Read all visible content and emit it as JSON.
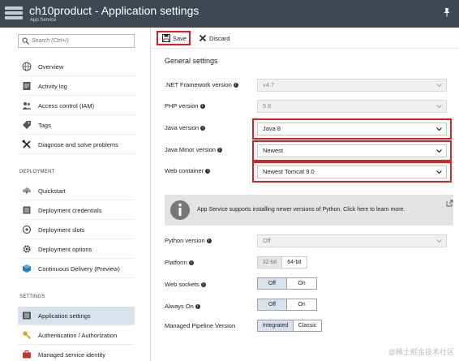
{
  "window": {
    "title": "ch10product - Application settings",
    "subtitle": "App Service"
  },
  "sidebar": {
    "search_placeholder": "Search (Ctrl+/)",
    "items": [
      {
        "label": "Overview",
        "icon": "globe-icon"
      },
      {
        "label": "Activity log",
        "icon": "activity-log-icon"
      },
      {
        "label": "Access control (IAM)",
        "icon": "people-icon"
      },
      {
        "label": "Tags",
        "icon": "tag-icon"
      },
      {
        "label": "Diagnose and solve problems",
        "icon": "tools-icon"
      }
    ],
    "deployment_header": "DEPLOYMENT",
    "deployment_items": [
      {
        "label": "Quickstart",
        "icon": "cloud-bolt-icon"
      },
      {
        "label": "Deployment credentials",
        "icon": "credentials-icon"
      },
      {
        "label": "Deployment slots",
        "icon": "slots-icon"
      },
      {
        "label": "Deployment options",
        "icon": "gear-icon"
      },
      {
        "label": "Continuous Delivery (Preview)",
        "icon": "cube-icon"
      }
    ],
    "settings_header": "SETTINGS",
    "settings_items": [
      {
        "label": "Application settings",
        "icon": "app-settings-icon",
        "active": true
      },
      {
        "label": "Authentication / Authorization",
        "icon": "key-icon"
      },
      {
        "label": "Managed service identity",
        "icon": "briefcase-icon"
      }
    ]
  },
  "toolbar": {
    "save_label": "Save",
    "discard_label": "Discard"
  },
  "general": {
    "title": "General settings",
    "net_label": ".NET Framework version",
    "net_value": "v4.7",
    "php_label": "PHP version",
    "php_value": "5.6",
    "java_label": "Java version",
    "java_value": "Java 8",
    "java_minor_label": "Java Minor version",
    "java_minor_value": "Newest",
    "web_container_label": "Web container",
    "web_container_value": "Newest Tomcat 9.0",
    "banner_text": "App Service supports installing newer versions of Python. Click here to learn more.",
    "python_label": "Python version",
    "python_value": "Off",
    "platform_label": "Platform",
    "platform_options": [
      "32-bit",
      "64-bit"
    ],
    "websockets_label": "Web sockets",
    "websockets_options": [
      "Off",
      "On"
    ],
    "always_on_label": "Always On",
    "always_on_options": [
      "Off",
      "On"
    ],
    "pipeline_label": "Managed Pipeline Version",
    "pipeline_options": [
      "Integrated",
      "Classic"
    ]
  },
  "watermark": "@稀土掘金技术社区",
  "colors": {
    "titlebar": "#3f4852",
    "highlight_red": "#e02020",
    "active_item": "#d9e2ec"
  }
}
